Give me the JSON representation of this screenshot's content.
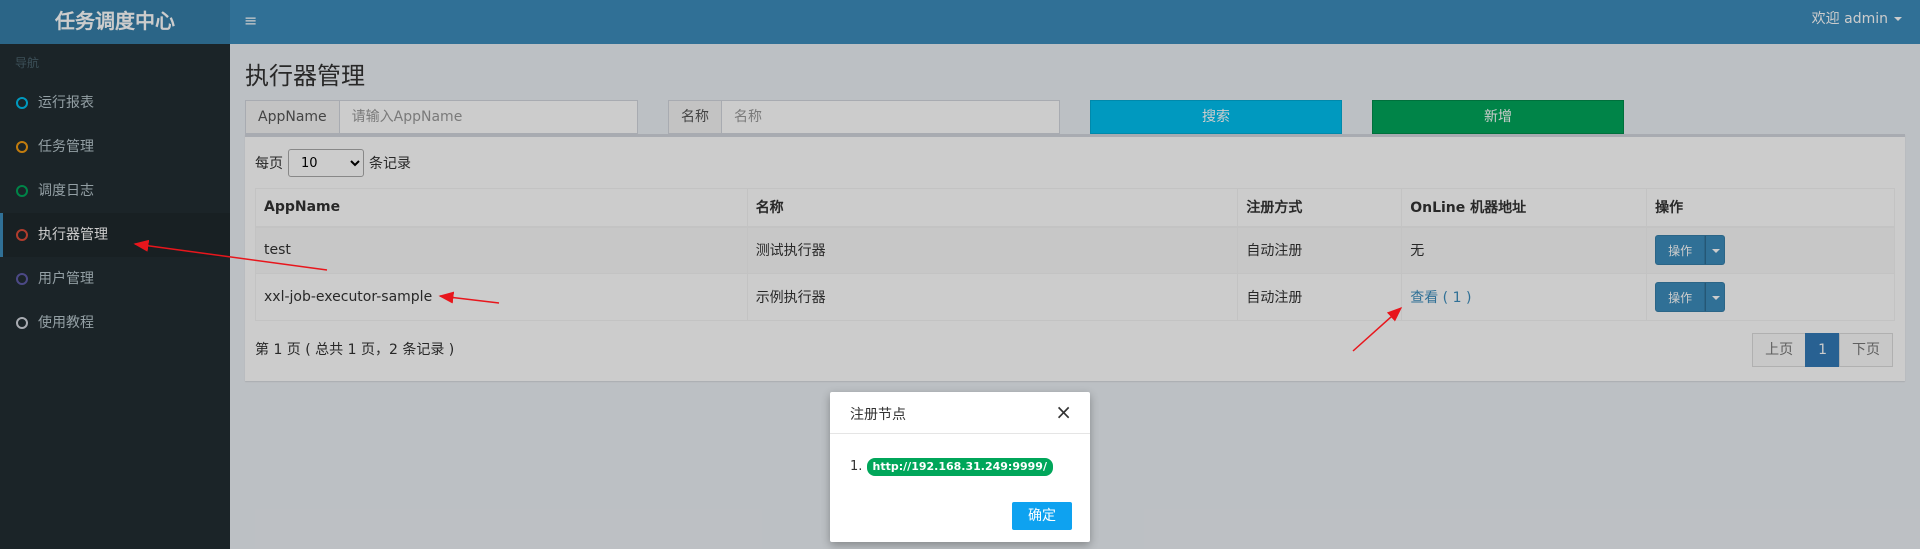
{
  "app": {
    "title": "任务调度中心"
  },
  "header": {
    "user_label": "欢迎 admin"
  },
  "sidebar": {
    "nav_header": "导航",
    "items": [
      {
        "label": "运行报表",
        "color": "#00c0ef"
      },
      {
        "label": "任务管理",
        "color": "#f39c12"
      },
      {
        "label": "调度日志",
        "color": "#00a65a"
      },
      {
        "label": "执行器管理",
        "color": "#dd4b39"
      },
      {
        "label": "用户管理",
        "color": "#605ca8"
      },
      {
        "label": "使用教程",
        "color": "#d2d6de"
      }
    ],
    "active_index": 3
  },
  "page": {
    "title": "执行器管理"
  },
  "filters": {
    "appname": {
      "label": "AppName",
      "placeholder": "请输入AppName"
    },
    "name": {
      "label": "名称",
      "placeholder": "名称"
    },
    "search_label": "搜索",
    "add_label": "新增"
  },
  "table": {
    "length_prefix": "每页",
    "length_value": "10",
    "length_suffix": "条记录",
    "headers": [
      "AppName",
      "名称",
      "注册方式",
      "OnLine 机器地址",
      "操作"
    ],
    "rows": [
      {
        "appname": "test",
        "name": "测试执行器",
        "reg": "自动注册",
        "online": "无",
        "op": "操作"
      },
      {
        "appname": "xxl-job-executor-sample",
        "name": "示例执行器",
        "reg": "自动注册",
        "online": "查看 ( 1 )",
        "op": "操作"
      }
    ],
    "info": "第 1 页 ( 总共 1 页，2 条记录 )",
    "pager": {
      "prev": "上页",
      "current": "1",
      "next": "下页"
    }
  },
  "modal": {
    "title": "注册节点",
    "close": "×",
    "list_number": "1.",
    "url": "http://192.168.31.249:9999/",
    "ok_label": "确定"
  }
}
